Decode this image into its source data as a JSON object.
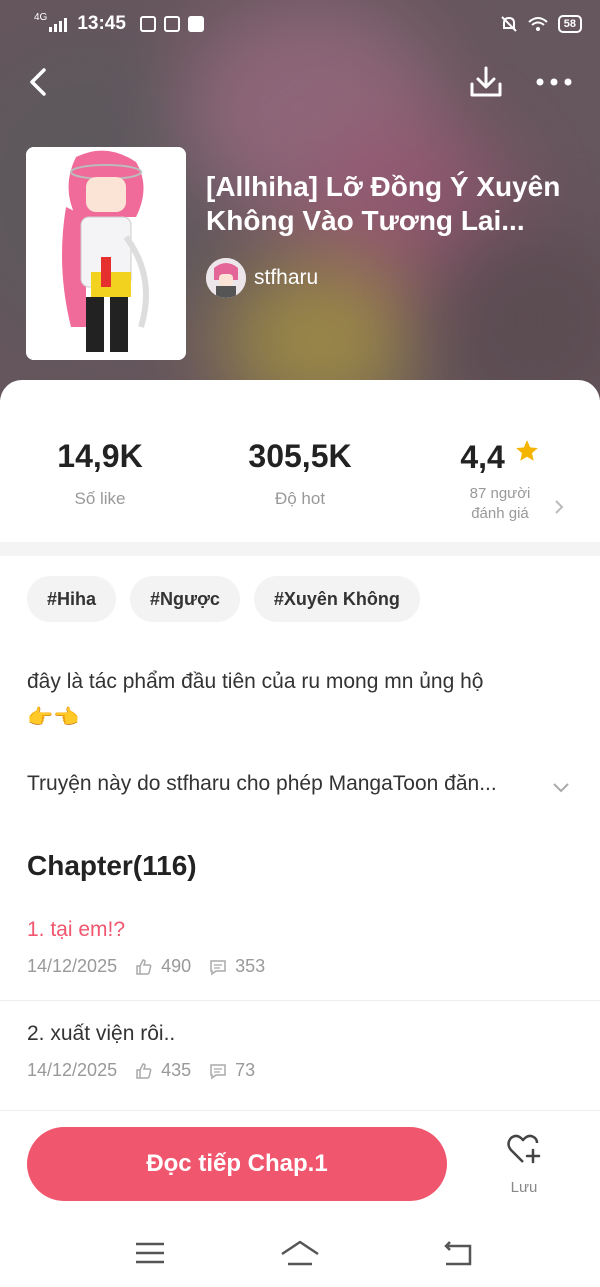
{
  "status_bar": {
    "network": "4G",
    "time": "13:45",
    "battery": "58"
  },
  "book": {
    "title": "[Allhiha] Lỡ Đồng Ý Xuyên Không Vào Tương Lai...",
    "author": "stfharu"
  },
  "stats": {
    "likes_value": "14,9K",
    "likes_label": "Số like",
    "hot_value": "305,5K",
    "hot_label": "Độ hot",
    "rating_value": "4,4",
    "rating_label_line1": "87 người",
    "rating_label_line2": "đánh giá"
  },
  "tags": [
    "#Hiha",
    "#Ngược",
    "#Xuyên Không"
  ],
  "description": "đây là tác phẩm đầu tiên của ru mong mn ủng hộ",
  "description_emoji": "👉👈",
  "permission_text": "Truyện này do stfharu cho phép MangaToon đăn...",
  "chapters_heading": "Chapter(116)",
  "chapters": [
    {
      "title": "1. tại em!?",
      "date": "14/12/2025",
      "likes": "490",
      "comments": "353"
    },
    {
      "title": "2. xuất viện rôi..",
      "date": "14/12/2025",
      "likes": "435",
      "comments": "73"
    }
  ],
  "actions": {
    "read_button": "Đọc tiếp Chap.1",
    "save_label": "Lưu"
  },
  "colors": {
    "accent": "#f0566e",
    "chapter_active": "#f0566e",
    "star": "#f5b400"
  }
}
